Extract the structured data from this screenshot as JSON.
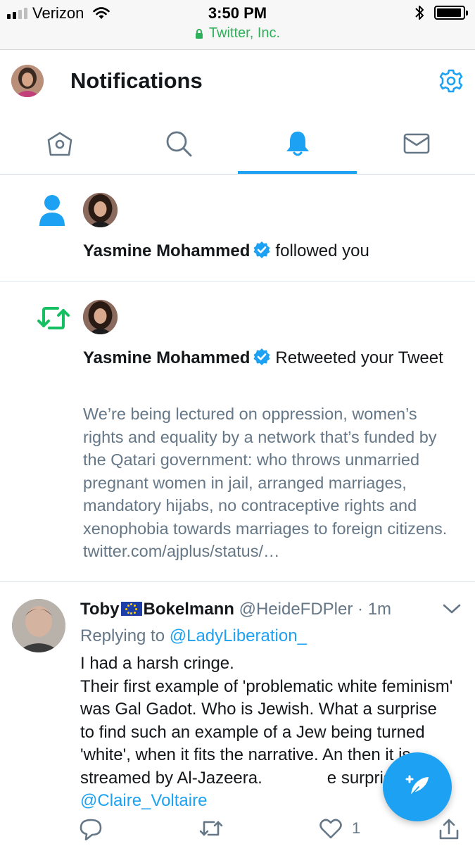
{
  "status_bar": {
    "carrier": "Verizon",
    "time": "3:50 PM",
    "url": "Twitter, Inc.",
    "signal_bars_filled": 2,
    "signal_bars_total": 4,
    "battery_level": 0.95
  },
  "header": {
    "title": "Notifications",
    "settings_icon": "gear-icon"
  },
  "tabs": [
    {
      "icon": "home-icon",
      "active": false
    },
    {
      "icon": "search-icon",
      "active": false
    },
    {
      "icon": "bell-icon",
      "active": true
    },
    {
      "icon": "mail-icon",
      "active": false
    }
  ],
  "notifications": [
    {
      "type_icon": "follow-person-icon",
      "user_name": "Yasmine Mohammed",
      "verified": true,
      "action": "followed you"
    },
    {
      "type_icon": "retweet-icon",
      "user_name": "Yasmine Mohammed",
      "verified": true,
      "action": "Retweeted your Tweet",
      "tweet_text": "We’re being lectured on oppression, women’s rights and equality by a network that’s funded by the Qatari government: who throws unmarried pregnant women in jail, arranged marriages, mandatory hijabs, no contraceptive rights and xenophobia towards marriages to foreign citizens. twitter.com/ajplus/status/…"
    }
  ],
  "tweet": {
    "name_first": "Toby",
    "flag_icon": "eu-flag-icon",
    "name_last": "Bokelmann",
    "handle": "@HeideFDPler",
    "separator": "·",
    "time": "1m",
    "replying_label": "Replying to",
    "replying_to": "@LadyLiberation_",
    "body": "I had a harsh cringe.\nTheir first example of 'problematic white feminism' was Gal Gadot. Who is Jewish. What a surprise to find such an example of a Jew being turned 'white', when it fits the narrative. An then it is streamed by Al-Jazeera.",
    "body_tail_hidden": "e",
    "body_end": "surprised.",
    "mention": "@Claire_Voltaire",
    "like_count": "1"
  },
  "colors": {
    "accent": "#1da1f2",
    "retweet_green": "#17bf63",
    "muted": "#657786",
    "url_green": "#2eaf5a"
  }
}
